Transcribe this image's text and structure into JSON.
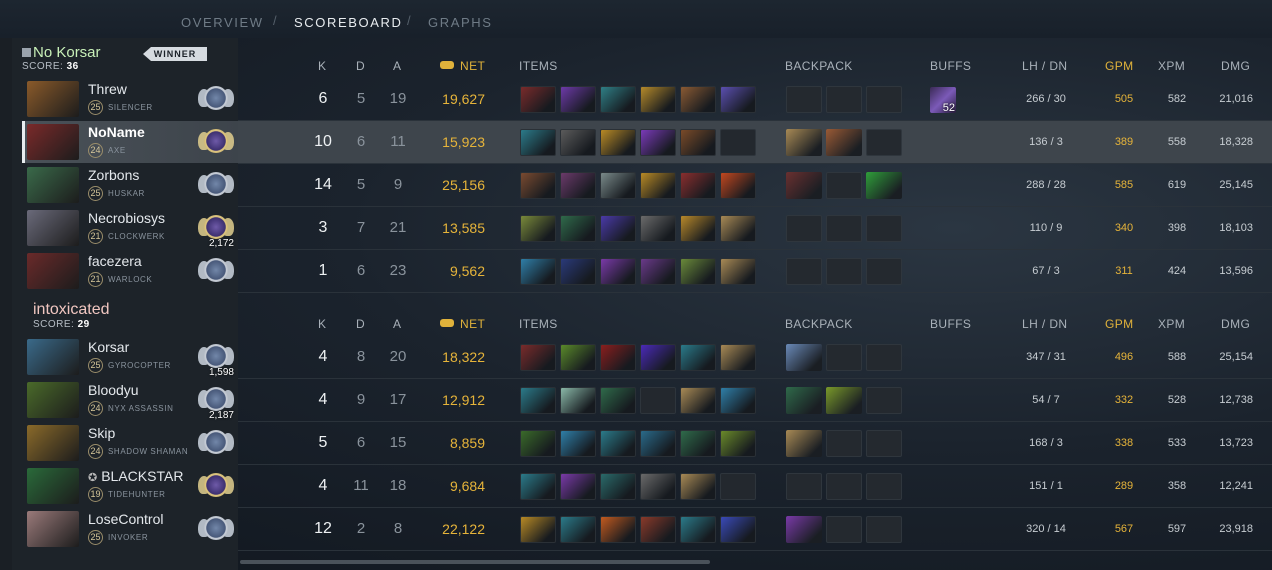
{
  "nav": {
    "tabs": [
      "OVERVIEW",
      "SCOREBOARD",
      "GRAPHS"
    ],
    "active": "SCOREBOARD",
    "separator": "/"
  },
  "headers": {
    "k": "K",
    "d": "D",
    "a": "A",
    "net": "NET",
    "items": "ITEMS",
    "backpack": "BACKPACK",
    "buffs": "BUFFS",
    "lhdn": "LH / DN",
    "gpm": "GPM",
    "xpm": "XPM",
    "dmg": "DMG"
  },
  "teams": [
    {
      "name": "No Korsar",
      "score_label": "SCORE:",
      "score": "36",
      "badge": "WINNER",
      "players": [
        {
          "name": "Threw",
          "level": "25",
          "hero": "SILENCER",
          "medal_num": "",
          "k": "6",
          "d": "5",
          "a": "19",
          "net": "19,627",
          "items": [
            "#7a2b2b",
            "#6d3aa8",
            "#2f7f86",
            "#b58a2a",
            "#8a5a33",
            "#5b4fb0"
          ],
          "backpack": [
            "",
            "",
            ""
          ],
          "buff": "52",
          "lh": "266",
          "dn": "30",
          "gpm": "505",
          "xpm": "582",
          "dmg": "21,016"
        },
        {
          "name": "NoName",
          "level": "24",
          "hero": "AXE",
          "medal_num": "",
          "k": "10",
          "d": "6",
          "a": "11",
          "net": "15,923",
          "items": [
            "#2b7b8a",
            "#5b5b5b",
            "#b88a25",
            "#7a3ab8",
            "#7a4a28",
            ""
          ],
          "backpack": [
            "#a88a55",
            "#9a5a35",
            ""
          ],
          "buff": "",
          "lh": "136",
          "dn": "3",
          "gpm": "389",
          "xpm": "558",
          "dmg": "18,328"
        },
        {
          "name": "Zorbons",
          "level": "25",
          "hero": "HUSKAR",
          "medal_num": "",
          "k": "14",
          "d": "5",
          "a": "9",
          "net": "25,156",
          "items": [
            "#7a4a30",
            "#6b3a6a",
            "#7a8a8a",
            "#b88a25",
            "#8a2e2e",
            "#c2471f"
          ],
          "backpack": [
            "#6a3030",
            "",
            "#2f9f3a"
          ],
          "buff": "",
          "lh": "288",
          "dn": "28",
          "gpm": "585",
          "xpm": "619",
          "dmg": "25,145"
        },
        {
          "name": "Necrobiosys",
          "level": "21",
          "hero": "CLOCKWERK",
          "medal_num": "2,172",
          "k": "3",
          "d": "7",
          "a": "21",
          "net": "13,585",
          "items": [
            "#7a8a3a",
            "#2f6a4a",
            "#4a3aa8",
            "#6b6b6b",
            "#b8892a",
            "#a88a55"
          ],
          "backpack": [
            "",
            "",
            ""
          ],
          "buff": "",
          "lh": "110",
          "dn": "9",
          "gpm": "340",
          "xpm": "398",
          "dmg": "18,103"
        },
        {
          "name": "facezera",
          "level": "21",
          "hero": "WARLOCK",
          "medal_num": "",
          "k": "1",
          "d": "6",
          "a": "23",
          "net": "9,562",
          "items": [
            "#2f7fa8",
            "#2a3a7a",
            "#7a3aa8",
            "#6a3a8a",
            "#6a8a3a",
            "#a88a55"
          ],
          "backpack": [
            "",
            "",
            ""
          ],
          "buff": "",
          "lh": "67",
          "dn": "3",
          "gpm": "311",
          "xpm": "424",
          "dmg": "13,596"
        }
      ]
    },
    {
      "name": "intoxicated",
      "score_label": "SCORE:",
      "score": "29",
      "badge": "",
      "players": [
        {
          "name": "Korsar",
          "level": "25",
          "hero": "GYROCOPTER",
          "medal_num": "1,598",
          "k": "4",
          "d": "8",
          "a": "20",
          "net": "18,322",
          "items": [
            "#7a2b2b",
            "#5a8a2a",
            "#8a1e1e",
            "#4a2ab8",
            "#2a7a8a",
            "#a88a55"
          ],
          "backpack": [
            "#6a8ab8",
            "",
            ""
          ],
          "buff": "",
          "lh": "347",
          "dn": "31",
          "gpm": "496",
          "xpm": "588",
          "dmg": "25,154"
        },
        {
          "name": "Bloodyu",
          "level": "24",
          "hero": "NYX ASSASSIN",
          "medal_num": "2,187",
          "k": "4",
          "d": "9",
          "a": "17",
          "net": "12,912",
          "items": [
            "#2b7b8a",
            "#8ab8a8",
            "#2f6a4a",
            "",
            "#a88a55",
            "#2f7fa8"
          ],
          "backpack": [
            "#2f6a4a",
            "#7a9a2a",
            ""
          ],
          "buff": "",
          "lh": "54",
          "dn": "7",
          "gpm": "332",
          "xpm": "528",
          "dmg": "12,738"
        },
        {
          "name": "Skip",
          "level": "24",
          "hero": "SHADOW SHAMAN",
          "medal_num": "",
          "k": "5",
          "d": "6",
          "a": "15",
          "net": "8,859",
          "items": [
            "#3a6a2a",
            "#2f7fa8",
            "#2b7b8a",
            "#2a6a8a",
            "#2f6a4a",
            "#6a8a2a"
          ],
          "backpack": [
            "#a88a55",
            "",
            ""
          ],
          "buff": "",
          "lh": "168",
          "dn": "3",
          "gpm": "338",
          "xpm": "533",
          "dmg": "13,723"
        },
        {
          "name": "BLACKSTAR",
          "level": "19",
          "hero": "TIDEHUNTER",
          "medal_num": "",
          "k": "4",
          "d": "11",
          "a": "18",
          "net": "9,684",
          "items": [
            "#2b7b8a",
            "#7a3aa8",
            "#2a6a6a",
            "#6a6a6a",
            "#a88a55",
            ""
          ],
          "backpack": [
            "",
            "",
            ""
          ],
          "buff": "",
          "lh": "151",
          "dn": "1",
          "gpm": "289",
          "xpm": "358",
          "dmg": "12,241"
        },
        {
          "name": "LoseControl",
          "level": "25",
          "hero": "INVOKER",
          "medal_num": "",
          "k": "12",
          "d": "2",
          "a": "8",
          "net": "22,122",
          "items": [
            "#b88a25",
            "#2b7b8a",
            "#c25a1f",
            "#8a3a2a",
            "#2b7b8a",
            "#3a4ab8"
          ],
          "backpack": [
            "#7a3aa8",
            "",
            ""
          ],
          "buff": "",
          "lh": "320",
          "dn": "14",
          "gpm": "567",
          "xpm": "597",
          "dmg": "23,918"
        }
      ]
    }
  ]
}
